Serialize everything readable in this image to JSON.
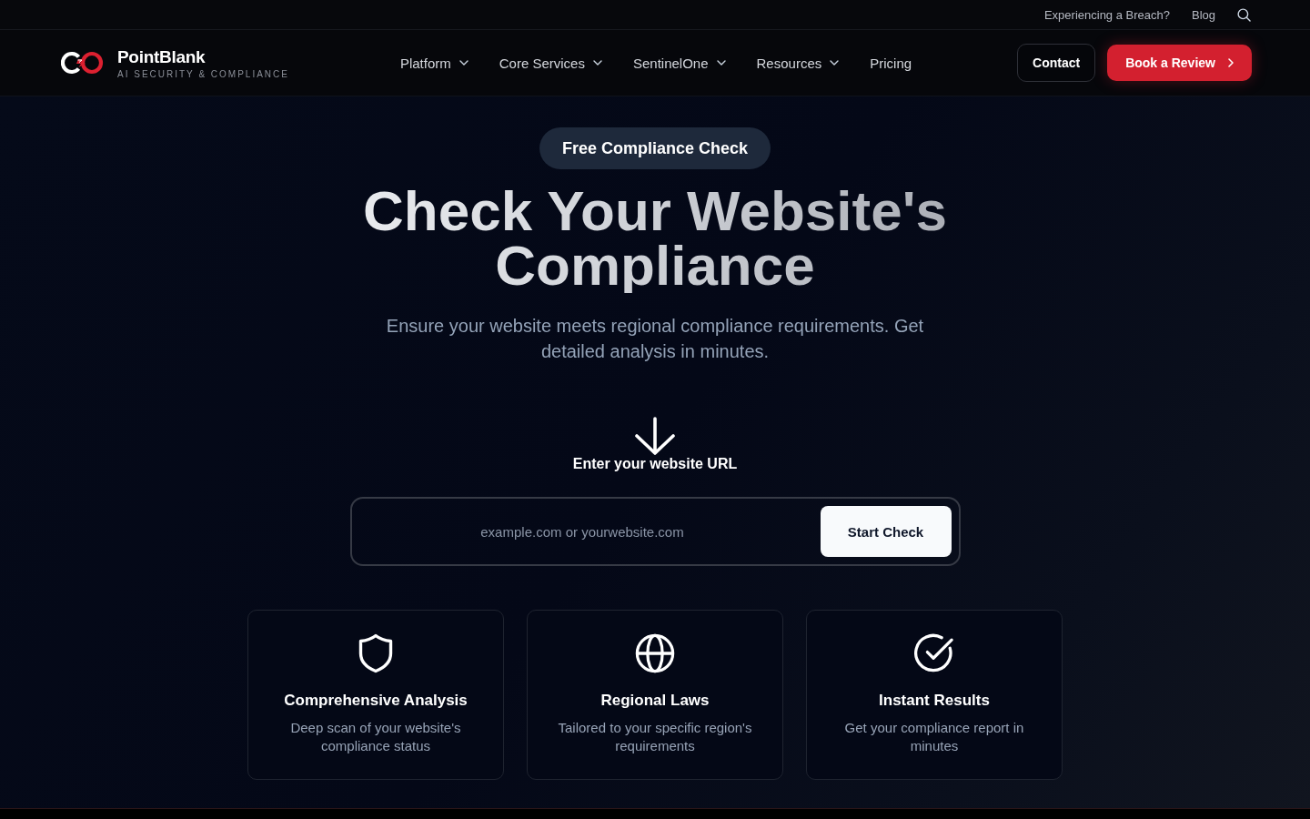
{
  "top_bar": {
    "links": [
      "Experiencing a Breach?",
      "Blog"
    ]
  },
  "nav": {
    "brand": {
      "name": "PointBlank",
      "tagline": "AI SECURITY & COMPLIANCE"
    },
    "menu": [
      {
        "label": "Platform",
        "has_dropdown": true
      },
      {
        "label": "Core Services",
        "has_dropdown": true
      },
      {
        "label": "SentinelOne",
        "has_dropdown": true
      },
      {
        "label": "Resources",
        "has_dropdown": true
      },
      {
        "label": "Pricing",
        "has_dropdown": false
      }
    ],
    "buttons": [
      {
        "label": "Contact",
        "kind": "outline"
      },
      {
        "label": "Book a Review",
        "kind": "primary"
      }
    ]
  },
  "hero": {
    "badge": "Free Compliance Check",
    "title": "Check Your Website's Compliance",
    "subtitle": "Ensure your website meets regional compliance requirements. Get detailed analysis in minutes."
  },
  "url_check": {
    "label": "Enter your website URL",
    "placeholder": "example.com or yourwebsite.com",
    "button": "Start Check"
  },
  "features": [
    {
      "title": "Comprehensive Analysis",
      "description": "Deep scan of your website's compliance status"
    },
    {
      "title": "Regional Laws",
      "description": "Tailored to your specific region's requirements"
    },
    {
      "title": "Instant Results",
      "description": "Get your compliance report in minutes"
    }
  ]
}
